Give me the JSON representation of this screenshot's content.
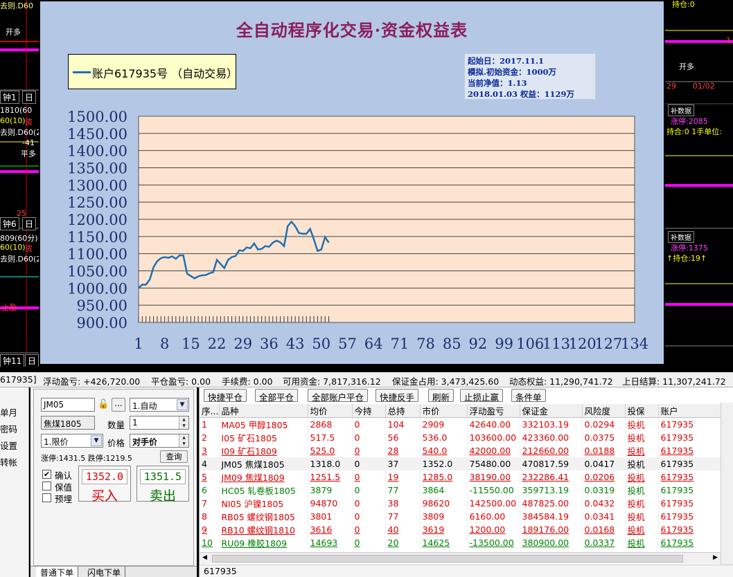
{
  "chart": {
    "title": "全自动程序化交易·资金权益表",
    "legend_label": "账户617935号 （自动交易）",
    "info": {
      "start": "起始日：2017.11.1",
      "initial": "模拟.初始资金：1000万",
      "net_value": "当前净值：1.13",
      "equity": "2018.01.03 权益：1129万"
    }
  },
  "chart_data": {
    "type": "line",
    "yticks": [
      "1500.00",
      "1450.00",
      "1400.00",
      "1350.00",
      "1300.00",
      "1250.00",
      "1200.00",
      "1150.00",
      "1100.00",
      "1050.00",
      "1000.00",
      "950.00",
      "900.00"
    ],
    "xticks": [
      "1",
      "8",
      "15",
      "22",
      "29",
      "36",
      "43",
      "50",
      "57",
      "64",
      "71",
      "78",
      "85",
      "92",
      "99",
      "106",
      "113",
      "120",
      "127",
      "134"
    ],
    "ylim": [
      900,
      1500
    ],
    "xlim": [
      1,
      134
    ],
    "grid": true,
    "legend_position": "top-left",
    "series": [
      {
        "name": "账户617935号 （自动交易）",
        "color": "#1f6fb2",
        "x": [
          1,
          2,
          3,
          4,
          5,
          6,
          7,
          8,
          9,
          10,
          11,
          12,
          13,
          14,
          15,
          16,
          17,
          18,
          19,
          20,
          21,
          22,
          23,
          24,
          25,
          26,
          27,
          28,
          29,
          30,
          31,
          32,
          33,
          34,
          35,
          36,
          37,
          38,
          39,
          40,
          41,
          42,
          43,
          44,
          45,
          46,
          47,
          48,
          49,
          50,
          51,
          52
        ],
        "y": [
          1000,
          1010,
          1010,
          1025,
          1060,
          1078,
          1087,
          1090,
          1088,
          1092,
          1085,
          1095,
          1095,
          1042,
          1035,
          1028,
          1034,
          1037,
          1038,
          1043,
          1046,
          1082,
          1070,
          1058,
          1082,
          1090,
          1093,
          1110,
          1108,
          1118,
          1116,
          1130,
          1112,
          1114,
          1122,
          1120,
          1132,
          1138,
          1133,
          1122,
          1180,
          1193,
          1180,
          1160,
          1158,
          1158,
          1172,
          1142,
          1108,
          1112,
          1148,
          1132
        ]
      }
    ]
  },
  "background": {
    "left_texts": [
      "去则.D60",
      "开多",
      "钟1",
      "日",
      "1810(60",
      "60(10)",
      "资",
      "去则.D60(2",
      "-41",
      "平多",
      "25",
      "钟6",
      "日",
      "809(60分)",
      "60(10)",
      "资",
      "去则.D60(2",
      "止盈",
      "钟11",
      "日"
    ],
    "right_texts": [
      "持仓:0",
      "1",
      "开多",
      "29",
      "01/02",
      "补数据",
      "涨停:2085",
      "持合:0 1手单位:",
      "补数据",
      "涨停:1375",
      "↑持仓:19↑"
    ]
  },
  "status": {
    "account": "617935]",
    "float_pl": "浮动盈亏: +426,720.00",
    "close_pl": "平仓盈亏: 0.00",
    "fee": "手续费: 0.00",
    "available": "可用资金: 7,817,316.12",
    "margin": "保证金占用: 3,473,425.60",
    "dynamic": "动态权益: 11,290,741.72",
    "prev": "上日结算: 11,307,241.72"
  },
  "left_menu": [
    "单月",
    "密码",
    "设置",
    "转帐"
  ],
  "order": {
    "contract": "JM05",
    "contract_name": "焦煤1805",
    "mode": "1.自动",
    "qty_label": "数量",
    "qty": "1",
    "price_type": "1.限价",
    "price_label": "价格",
    "price_value": "对手价",
    "limits": "涨停:1431.5 跌停:1219.5",
    "query_btn": "查询",
    "more_btn": "...",
    "checks": [
      {
        "label": "确认",
        "checked": "✔"
      },
      {
        "label": "保值",
        "checked": ""
      },
      {
        "label": "预埋",
        "checked": ""
      }
    ],
    "buy_price": "1352.0",
    "buy_label": "买入",
    "sell_price": "1351.5",
    "sell_label": "卖出"
  },
  "bottom_tabs": [
    "普通下单",
    "闪电下单"
  ],
  "toolbar": [
    "快捷平仓",
    "全部平仓",
    "全部账户平仓",
    "快捷反手",
    "刷新",
    "止损止赢",
    "条件单"
  ],
  "positions": {
    "headers": [
      "序...",
      "品种",
      "均价",
      "今持",
      "总持",
      "市价",
      "浮动盈亏",
      "保证金",
      "风险度",
      "投保",
      "账户"
    ],
    "rows": [
      {
        "cls": "red",
        "cells": [
          "1",
          "MA05 甲醇1805",
          "2868",
          "0",
          "104",
          "2909",
          "42640.00",
          "332103.19",
          "0.0294",
          "投机",
          "617935"
        ]
      },
      {
        "cls": "red",
        "cells": [
          "2",
          "I05 矿石1805",
          "517.5",
          "0",
          "56",
          "536.0",
          "103600.00",
          "423360.00",
          "0.0375",
          "投机",
          "617935"
        ]
      },
      {
        "cls": "red u",
        "cells": [
          "3",
          "I09 矿石1809",
          "525.0",
          "0",
          "28",
          "540.0",
          "42000.00",
          "212660.00",
          "0.0188",
          "投机",
          "617935"
        ]
      },
      {
        "cls": "black",
        "cells": [
          "4",
          "JM05 焦煤1805",
          "1318.0",
          "0",
          "37",
          "1352.0",
          "75480.00",
          "470817.59",
          "0.0417",
          "投机",
          "617935"
        ]
      },
      {
        "cls": "red u",
        "cells": [
          "5",
          "JM09 焦煤1809",
          "1251.5",
          "0",
          "19",
          "1285.0",
          "38190.00",
          "232286.41",
          "0.0206",
          "投机",
          "617935"
        ]
      },
      {
        "cls": "green",
        "cells": [
          "6",
          "HC05 轧卷板1805",
          "3879",
          "0",
          "77",
          "3864",
          "-11550.00",
          "359713.19",
          "0.0319",
          "投机",
          "617935"
        ]
      },
      {
        "cls": "red",
        "cells": [
          "7",
          "NI05 沪镍1805",
          "94870",
          "0",
          "38",
          "98620",
          "142500.00",
          "487825.00",
          "0.0432",
          "投机",
          "617935"
        ]
      },
      {
        "cls": "red",
        "cells": [
          "8",
          "RB05 螺纹钢1805",
          "3801",
          "0",
          "77",
          "3809",
          "6160.00",
          "384584.19",
          "0.0341",
          "投机",
          "617935"
        ]
      },
      {
        "cls": "red u",
        "cells": [
          "9",
          "RB10 螺纹钢1810",
          "3616",
          "0",
          "40",
          "3619",
          "1200.00",
          "189176.00",
          "0.0168",
          "投机",
          "617935"
        ]
      },
      {
        "cls": "green u",
        "cells": [
          "10",
          "RU09 橡胶1809",
          "14693",
          "0",
          "20",
          "14625",
          "-13500.00",
          "380900.00",
          "0.0337",
          "投机",
          "617935"
        ]
      }
    ]
  },
  "footer_account": "617935"
}
